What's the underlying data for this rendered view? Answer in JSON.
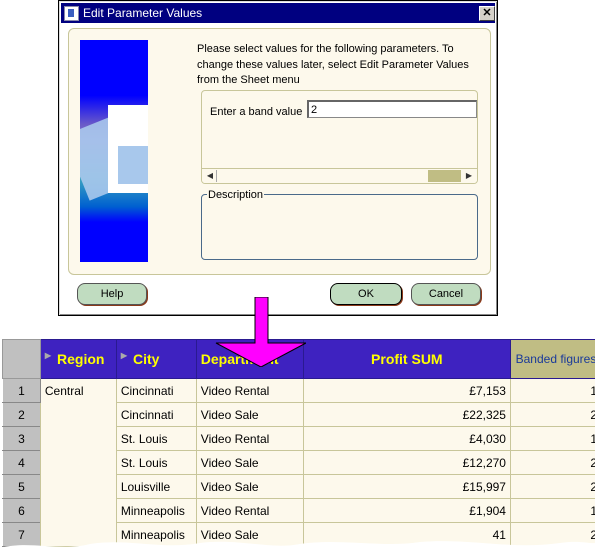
{
  "dialog": {
    "title": "Edit Parameter Values",
    "intro": "Please select values for the following parameters.  To change these values later, select Edit Parameter Values from the Sheet menu",
    "band_label": "Enter a band value",
    "band_value": "2",
    "description_label": "Description",
    "buttons": {
      "help": "Help",
      "ok": "OK",
      "cancel": "Cancel"
    }
  },
  "colors": {
    "arrow": "#ff00ff",
    "header_bg": "#3e22c0",
    "header_text": "#ffff00",
    "title_bar": "#000080"
  },
  "table": {
    "headers": [
      "Region",
      "City",
      "Department",
      "Profit SUM",
      "Banded figures"
    ],
    "rows": [
      {
        "n": "1",
        "region": "Central",
        "city": "Cincinnati",
        "dept": "Video Rental",
        "profit": "£7,153",
        "band": "1"
      },
      {
        "n": "2",
        "region": "",
        "city": "Cincinnati",
        "dept": "Video Sale",
        "profit": "£22,325",
        "band": "2"
      },
      {
        "n": "3",
        "region": "",
        "city": "St. Louis",
        "dept": "Video Rental",
        "profit": "£4,030",
        "band": "1"
      },
      {
        "n": "4",
        "region": "",
        "city": "St. Louis",
        "dept": "Video Sale",
        "profit": "£12,270",
        "band": "2"
      },
      {
        "n": "5",
        "region": "",
        "city": "Louisville",
        "dept": "Video Sale",
        "profit": "£15,997",
        "band": "2"
      },
      {
        "n": "6",
        "region": "",
        "city": "Minneapolis",
        "dept": "Video Rental",
        "profit": "£1,904",
        "band": "1"
      },
      {
        "n": "7",
        "region": "",
        "city": "Minneapolis",
        "dept": "Video Sale",
        "profit": "41",
        "band": "2"
      }
    ]
  }
}
